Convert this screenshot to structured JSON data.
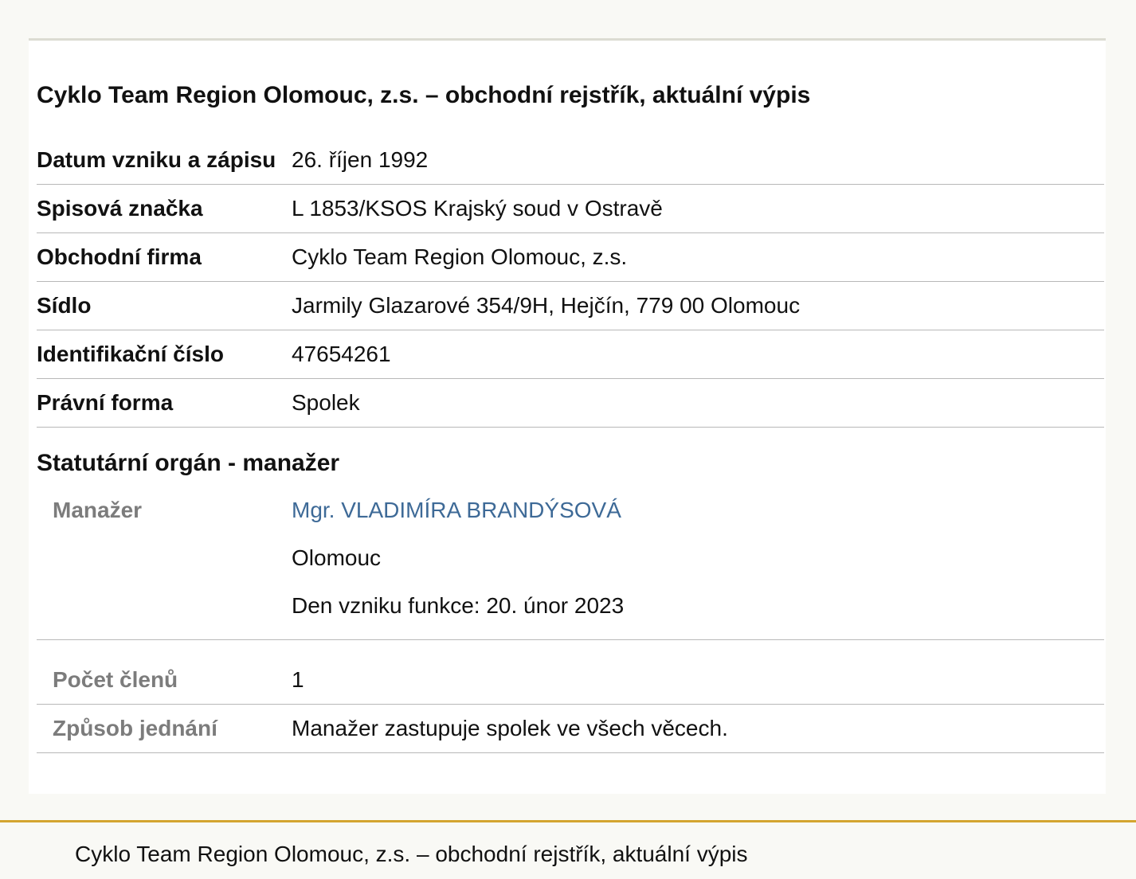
{
  "page": {
    "title": "Cyklo Team Region Olomouc, z.s. – obchodní rejstřík, aktuální výpis"
  },
  "rows": [
    {
      "label": "Datum vzniku a zápisu",
      "value": "26. říjen 1992"
    },
    {
      "label": "Spisová značka",
      "value": "L 1853/KSOS Krajský soud v Ostravě"
    },
    {
      "label": "Obchodní firma",
      "value": "Cyklo Team Region Olomouc, z.s."
    },
    {
      "label": "Sídlo",
      "value": "Jarmily Glazarové 354/9H, Hejčín, 779 00 Olomouc"
    },
    {
      "label": "Identifikační číslo",
      "value": "47654261"
    },
    {
      "label": "Právní forma",
      "value": "Spolek"
    }
  ],
  "statutory": {
    "heading": "Statutární orgán - manažer",
    "manager": {
      "label": "Manažer",
      "name": "Mgr. VLADIMÍRA BRANDÝSOVÁ",
      "city": "Olomouc",
      "since": "Den vzniku funkce: 20. únor 2023"
    },
    "member_count": {
      "label": "Počet členů",
      "value": "1"
    },
    "acting": {
      "label": "Způsob jednání",
      "value": "Manažer zastupuje spolek ve všech věcech."
    }
  },
  "footer": {
    "text": "Cyklo Team Region Olomouc, z.s. – obchodní rejstřík, aktuální výpis"
  },
  "colors": {
    "link": "#3e6a97",
    "muted_label": "#7c7c7c",
    "footer_border": "#d4a530"
  }
}
